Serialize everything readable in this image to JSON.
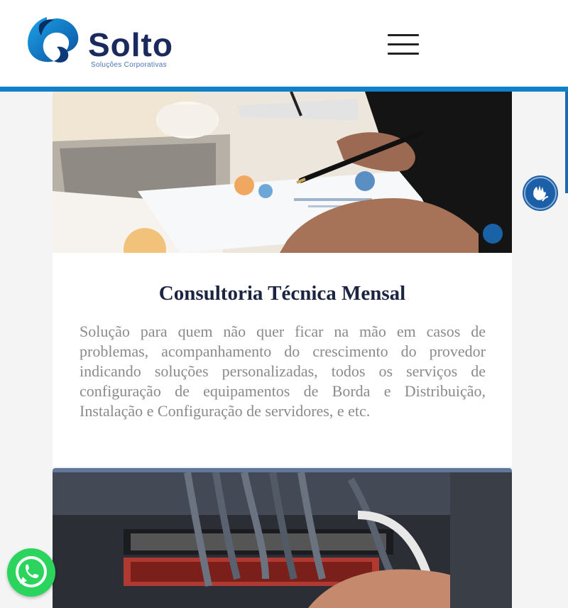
{
  "header": {
    "brand_name": "Solto",
    "brand_tagline": "Soluções Corporativas",
    "menu_icon": "hamburger-icon"
  },
  "card1": {
    "image_alt": "hands-writing-charts-photo",
    "title": "Consultoria Técnica Mensal",
    "description": "Solução para quem não quer ficar na mão em casos de problemas, acompanhamento do crescimento do provedor indicando soluções personalizadas, todos os serviços de configuração de equipamentos de Borda e Distribuição, Instalação e Configuração de servidores, e etc."
  },
  "card2": {
    "image_alt": "network-cables-photo",
    "accent_color": "#61789a"
  },
  "floating": {
    "accessibility_icon": "sign-language-hands-icon",
    "whatsapp_icon": "whatsapp-icon"
  },
  "colors": {
    "brand_dark": "#1a2a5e",
    "brand_blue": "#1080c8",
    "whatsapp_green": "#2bd45c",
    "accessibility_blue": "#1b5fa8"
  }
}
